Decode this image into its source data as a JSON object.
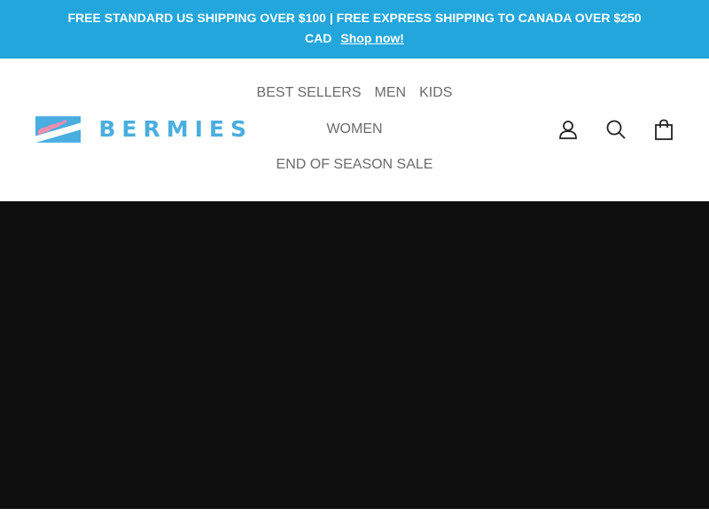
{
  "announcement": {
    "text": "FREE STANDARD US SHIPPING OVER $100 | FREE EXPRESS SHIPPING TO CANADA OVER $250 CAD",
    "link_label": "Shop now!"
  },
  "brand": {
    "name": "BERMIES"
  },
  "nav": {
    "best_sellers": "BEST SELLERS",
    "men": "MEN",
    "kids": "KIDS",
    "women": "WOMEN",
    "sale": "END OF SEASON SALE"
  },
  "icons": {
    "account": "user-icon",
    "search": "search-icon",
    "cart": "shopping-bag-icon"
  },
  "colors": {
    "announcement_bg": "#22a6dc",
    "brand_blue": "#4aaee0",
    "brand_pink": "#f28bb0",
    "hero_bg": "#0f0f0f",
    "nav_text": "#6b6b6b"
  }
}
